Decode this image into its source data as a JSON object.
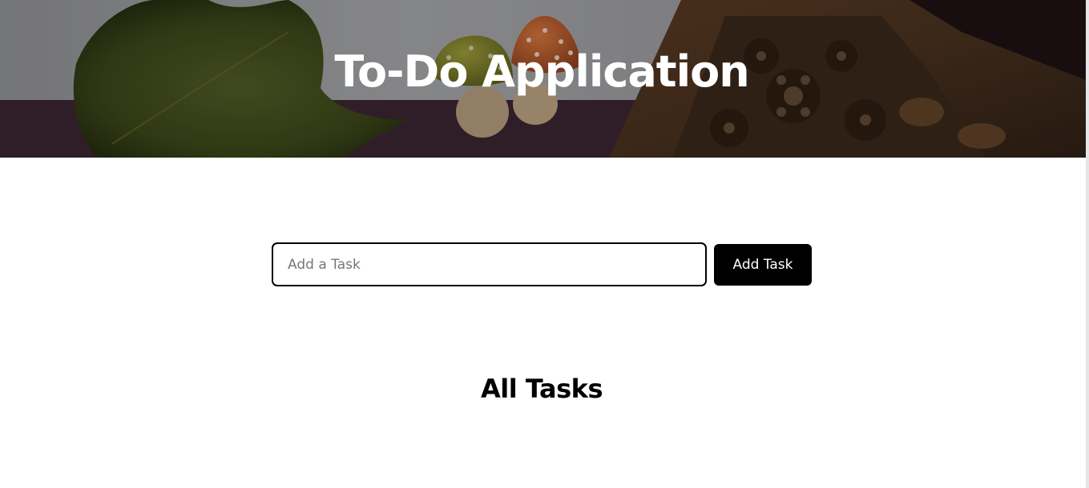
{
  "hero": {
    "title": "To-Do Application"
  },
  "form": {
    "input_placeholder": "Add a Task",
    "input_value": "",
    "add_button_label": "Add Task"
  },
  "tasks_section": {
    "title": "All Tasks",
    "tasks": []
  },
  "colors": {
    "button_background": "#000000",
    "button_text": "#ffffff",
    "input_border": "#000000",
    "hero_title": "#ffffff"
  }
}
